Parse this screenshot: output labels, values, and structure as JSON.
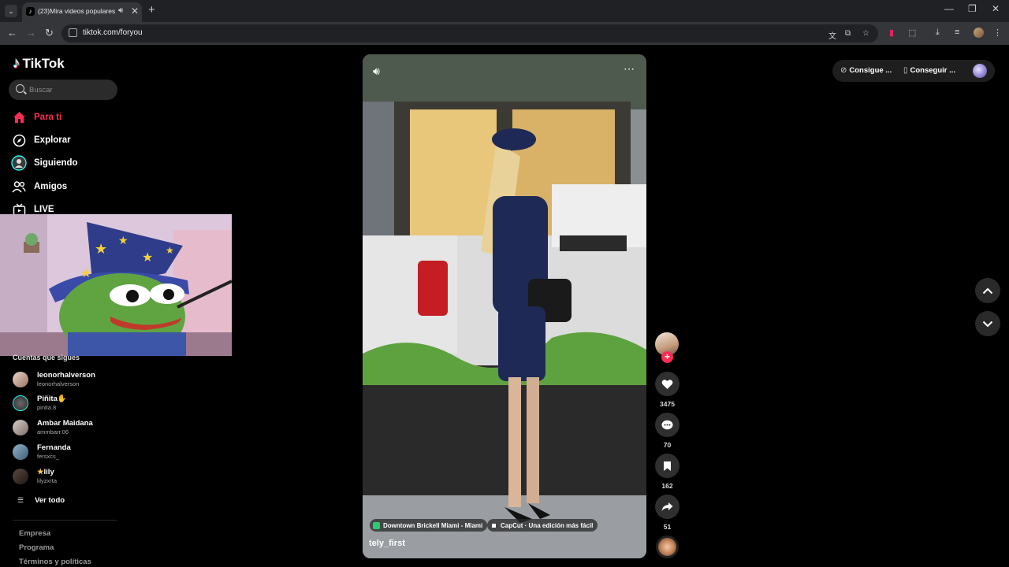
{
  "browser": {
    "tab_title": "(23)Mira videos populares",
    "url": "tiktok.com/foryou"
  },
  "sidebar": {
    "brand": "TikTok",
    "search_placeholder": "Buscar",
    "nav": [
      {
        "label": "Para ti",
        "icon": "home-icon",
        "active": true
      },
      {
        "label": "Explorar",
        "icon": "compass-icon"
      },
      {
        "label": "Siguiendo",
        "icon": "following-avatar-icon"
      },
      {
        "label": "Amigos",
        "icon": "friends-icon"
      },
      {
        "label": "LIVE",
        "icon": "live-icon"
      }
    ],
    "following_title": "Cuentas que sigues",
    "accounts": [
      {
        "name": "leonorhalverson",
        "username": "leonorhalverson"
      },
      {
        "name": "Piñita",
        "username": "pinita.8"
      },
      {
        "name": "Ambar Maidana",
        "username": "ammbarr.06"
      },
      {
        "name": "Fernanda",
        "username": "fersxcs_"
      },
      {
        "name": "lily",
        "username": "lilyzxrta"
      }
    ],
    "see_all": "Ver todo",
    "footer_links": [
      "Empresa",
      "Programa",
      "Términos y políticas"
    ]
  },
  "video": {
    "location_chip": "Downtown Brickell Miami - Miami",
    "capcut_chip": "CapCut · Una edición más fácil",
    "author": "tely_first"
  },
  "actions": {
    "likes": "3475",
    "comments": "70",
    "saves": "162",
    "shares": "51"
  },
  "topbar": {
    "get_coins": "Consigue ...",
    "get_app": "Conseguir ..."
  },
  "colors": {
    "accent": "#fe2c55",
    "background": "#000000"
  }
}
